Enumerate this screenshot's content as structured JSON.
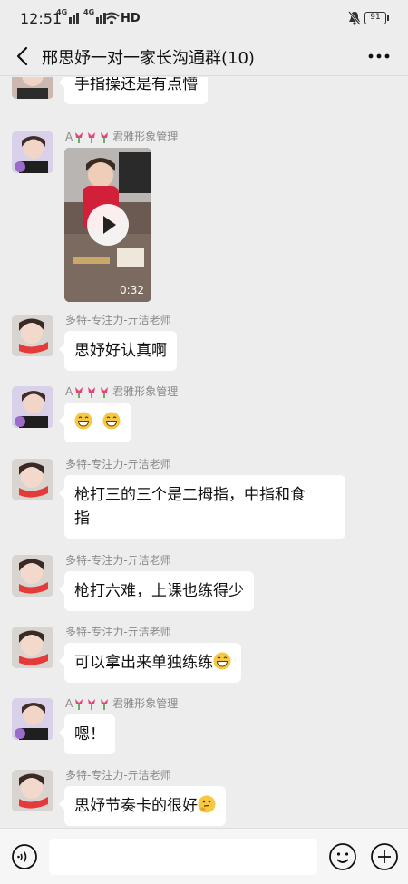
{
  "status_bar": {
    "time": "12:51",
    "network_1": "4G",
    "network_2": "4G",
    "hd_label": "HD",
    "battery": "91"
  },
  "header": {
    "title": "邢思妤一对一家长沟通群(10)"
  },
  "messages": [
    {
      "sender": "",
      "text": "手指操还是有点懵",
      "avatar": "mother"
    },
    {
      "sender_prefix": "A",
      "sender": "君雅形象管理",
      "type": "video",
      "duration": "0:32",
      "avatar": "mother"
    },
    {
      "sender": "多特-专注力-亓洁老师",
      "text": "思妤好认真啊",
      "avatar": "teacher"
    },
    {
      "sender_prefix": "A",
      "sender": "君雅形象管理",
      "text": "",
      "emojis": [
        "grin-emoji",
        "grin-emoji"
      ],
      "avatar": "mother"
    },
    {
      "sender": "多特-专注力-亓洁老师",
      "text_line1": "枪打三的三个是二拇指，中指和食",
      "text_line2": "指",
      "avatar": "teacher"
    },
    {
      "sender": "多特-专注力-亓洁老师",
      "text": "枪打六难，上课也练得少",
      "avatar": "teacher"
    },
    {
      "sender": "多特-专注力-亓洁老师",
      "text": "可以拿出来单独练练",
      "emojis": [
        "grin-emoji"
      ],
      "avatar": "teacher"
    },
    {
      "sender_prefix": "A",
      "sender": "君雅形象管理",
      "text": "嗯！",
      "avatar": "mother"
    },
    {
      "sender": "多特-专注力-亓洁老师",
      "text": "思妤节奏卡的很好",
      "emojis": [
        "thinking-emoji"
      ],
      "avatar": "teacher"
    }
  ],
  "input_bar": {
    "voice_icon": "voice-icon",
    "emoji_icon": "smile-icon",
    "plus_icon": "plus-icon"
  },
  "colors": {
    "background": "#ededed",
    "bubble": "#ffffff",
    "sender_text": "#8a8a8a"
  }
}
